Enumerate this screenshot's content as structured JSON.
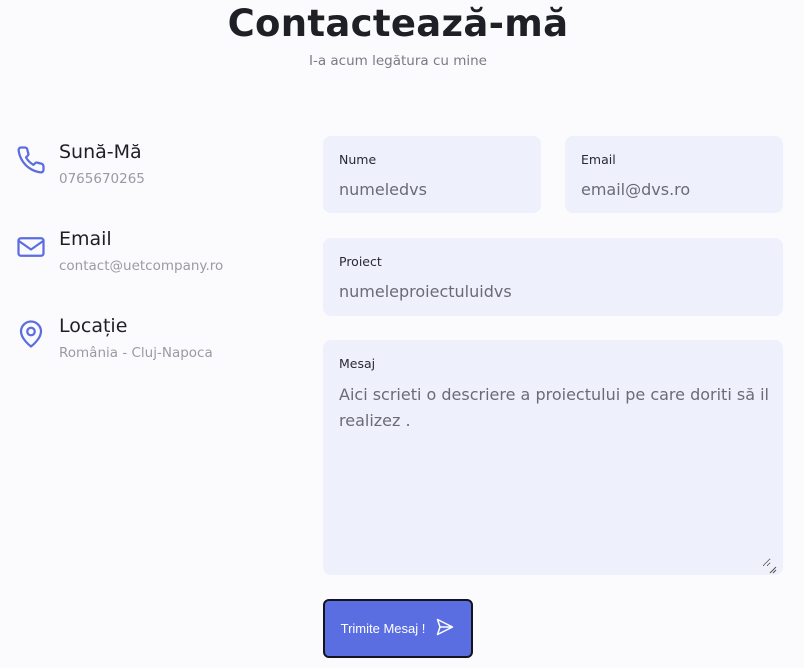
{
  "header": {
    "title": "Contactează-mă",
    "subtitle": "I-a acum legătura cu mine"
  },
  "contact_info": [
    {
      "icon": "phone-icon",
      "label": "Sună-Mă",
      "value": "0765670265"
    },
    {
      "icon": "envelope-icon",
      "label": "Email",
      "value": "contact@uetcompany.ro"
    },
    {
      "icon": "location-pin-icon",
      "label": "Locație",
      "value": "România - Cluj-Napoca"
    }
  ],
  "form": {
    "name": {
      "label": "Nume",
      "placeholder": "numeledvs"
    },
    "email": {
      "label": "Email",
      "placeholder": "email@dvs.ro"
    },
    "project": {
      "label": "Proiect",
      "placeholder": "numeleproiectuluidvs"
    },
    "message": {
      "label": "Mesaj",
      "value": "Aici scrieti o descriere a proiectului pe care doriti să il realizez ."
    },
    "submit_label": "Trimite Mesaj !"
  },
  "colors": {
    "accent": "#5b6ee1",
    "field_bg": "#eef0fb",
    "icon": "#5b6ee1"
  }
}
